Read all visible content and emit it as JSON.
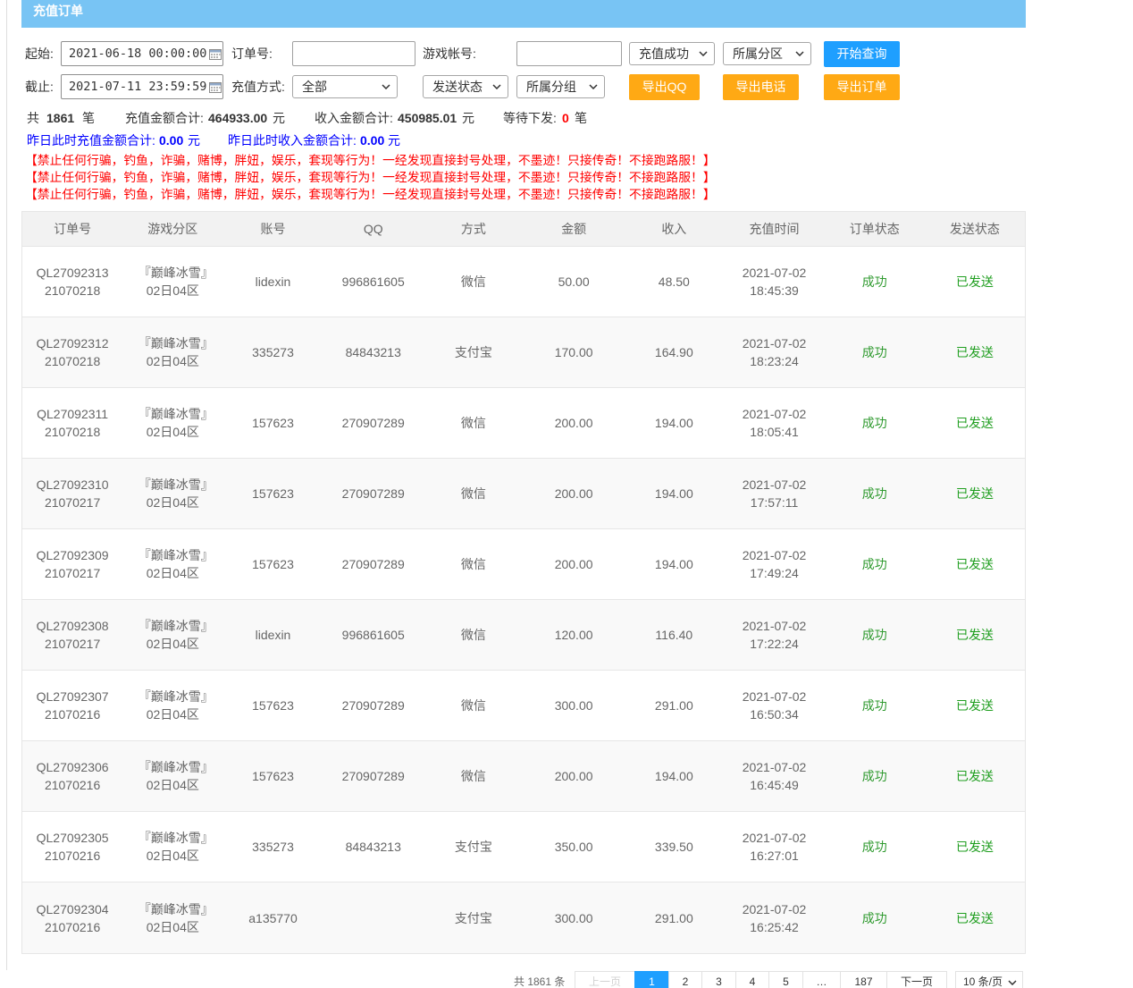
{
  "header": {
    "title": "充值订单"
  },
  "filters": {
    "start_label": "起始:",
    "start_value": "2021-06-18 00:00:00",
    "end_label": "截止:",
    "end_value": "2021-07-11 23:59:59",
    "order_no_label": "订单号:",
    "order_no_value": "",
    "game_account_label": "游戏帐号:",
    "game_account_value": "",
    "pay_method_label": "充值方式:",
    "pay_method_selected": "全部",
    "recharge_status_selected": "充值成功",
    "zone_selected": "所属分区",
    "send_status_selected": "发送状态",
    "group_selected": "所属分组",
    "search_button": "开始查询",
    "export_qq_button": "导出QQ",
    "export_phone_button": "导出电话",
    "export_order_button": "导出订单"
  },
  "summary": {
    "total_prefix": "共",
    "total_count": "1861",
    "total_unit": "笔",
    "recharge_label": "充值金额合计:",
    "recharge_total": "464933.00",
    "recharge_unit": "元",
    "income_label": "收入金额合计:",
    "income_total": "450985.01",
    "income_unit": "元",
    "pending_label": "等待下发:",
    "pending_count": "0",
    "pending_unit": "笔",
    "yesterday_recharge_label": "昨日此时充值金额合计:",
    "yesterday_recharge_total": "0.00",
    "yesterday_recharge_unit": "元",
    "yesterday_income_label": "昨日此时收入金额合计:",
    "yesterday_income_total": "0.00",
    "yesterday_income_unit": "元"
  },
  "notices": [
    "【禁止任何行骗，钓鱼，诈骗，赌博，胖妞，娱乐，套现等行为！一经发现直接封号处理，不墨迹！只接传奇！不接跑路服！】",
    "【禁止任何行骗，钓鱼，诈骗，赌博，胖妞，娱乐，套现等行为！一经发现直接封号处理，不墨迹！只接传奇！不接跑路服！】",
    "【禁止任何行骗，钓鱼，诈骗，赌博，胖妞，娱乐，套现等行为！一经发现直接封号处理，不墨迹！只接传奇！不接跑路服！】"
  ],
  "table": {
    "columns": [
      "订单号",
      "游戏分区",
      "账号",
      "QQ",
      "方式",
      "金额",
      "收入",
      "充值时间",
      "订单状态",
      "发送状态"
    ],
    "rows": [
      {
        "order_no": "QL2709231321070218",
        "zone": "『巅峰冰雪』02日04区",
        "account": "lidexin",
        "qq": "996861605",
        "method": "微信",
        "amount": "50.00",
        "income": "48.50",
        "time": "2021-07-02 18:45:39",
        "order_status": "成功",
        "send_status": "已发送"
      },
      {
        "order_no": "QL2709231221070218",
        "zone": "『巅峰冰雪』02日04区",
        "account": "335273",
        "qq": "84843213",
        "method": "支付宝",
        "amount": "170.00",
        "income": "164.90",
        "time": "2021-07-02 18:23:24",
        "order_status": "成功",
        "send_status": "已发送"
      },
      {
        "order_no": "QL2709231121070218",
        "zone": "『巅峰冰雪』02日04区",
        "account": "157623",
        "qq": "270907289",
        "method": "微信",
        "amount": "200.00",
        "income": "194.00",
        "time": "2021-07-02 18:05:41",
        "order_status": "成功",
        "send_status": "已发送"
      },
      {
        "order_no": "QL2709231021070217",
        "zone": "『巅峰冰雪』02日04区",
        "account": "157623",
        "qq": "270907289",
        "method": "微信",
        "amount": "200.00",
        "income": "194.00",
        "time": "2021-07-02 17:57:11",
        "order_status": "成功",
        "send_status": "已发送"
      },
      {
        "order_no": "QL2709230921070217",
        "zone": "『巅峰冰雪』02日04区",
        "account": "157623",
        "qq": "270907289",
        "method": "微信",
        "amount": "200.00",
        "income": "194.00",
        "time": "2021-07-02 17:49:24",
        "order_status": "成功",
        "send_status": "已发送"
      },
      {
        "order_no": "QL2709230821070217",
        "zone": "『巅峰冰雪』02日04区",
        "account": "lidexin",
        "qq": "996861605",
        "method": "微信",
        "amount": "120.00",
        "income": "116.40",
        "time": "2021-07-02 17:22:24",
        "order_status": "成功",
        "send_status": "已发送"
      },
      {
        "order_no": "QL2709230721070216",
        "zone": "『巅峰冰雪』02日04区",
        "account": "157623",
        "qq": "270907289",
        "method": "微信",
        "amount": "300.00",
        "income": "291.00",
        "time": "2021-07-02 16:50:34",
        "order_status": "成功",
        "send_status": "已发送"
      },
      {
        "order_no": "QL2709230621070216",
        "zone": "『巅峰冰雪』02日04区",
        "account": "157623",
        "qq": "270907289",
        "method": "微信",
        "amount": "200.00",
        "income": "194.00",
        "time": "2021-07-02 16:45:49",
        "order_status": "成功",
        "send_status": "已发送"
      },
      {
        "order_no": "QL2709230521070216",
        "zone": "『巅峰冰雪』02日04区",
        "account": "335273",
        "qq": "84843213",
        "method": "支付宝",
        "amount": "350.00",
        "income": "339.50",
        "time": "2021-07-02 16:27:01",
        "order_status": "成功",
        "send_status": "已发送"
      },
      {
        "order_no": "QL2709230421070216",
        "zone": "『巅峰冰雪』02日04区",
        "account": "a135770",
        "qq": "",
        "method": "支付宝",
        "amount": "300.00",
        "income": "291.00",
        "time": "2021-07-02 16:25:42",
        "order_status": "成功",
        "send_status": "已发送"
      }
    ]
  },
  "pagination": {
    "total_text": "共 1861 条",
    "prev": "上一页",
    "pages": [
      "1",
      "2",
      "3",
      "4",
      "5"
    ],
    "ellipsis": "…",
    "last_page": "187",
    "next": "下一页",
    "page_size": "10 条/页",
    "current": 1
  },
  "theme": {
    "header_bar": "#78c4f4",
    "primary": "#1e9fff",
    "warning": "#ffa914",
    "notice": "#ff0000",
    "yesterday_text": "#0000ff",
    "success": "#2f9a2f",
    "sent": "#1f9e1f"
  },
  "icons": {
    "date_picker": "calendar-icon",
    "dropdown": "chevron-down-icon"
  }
}
